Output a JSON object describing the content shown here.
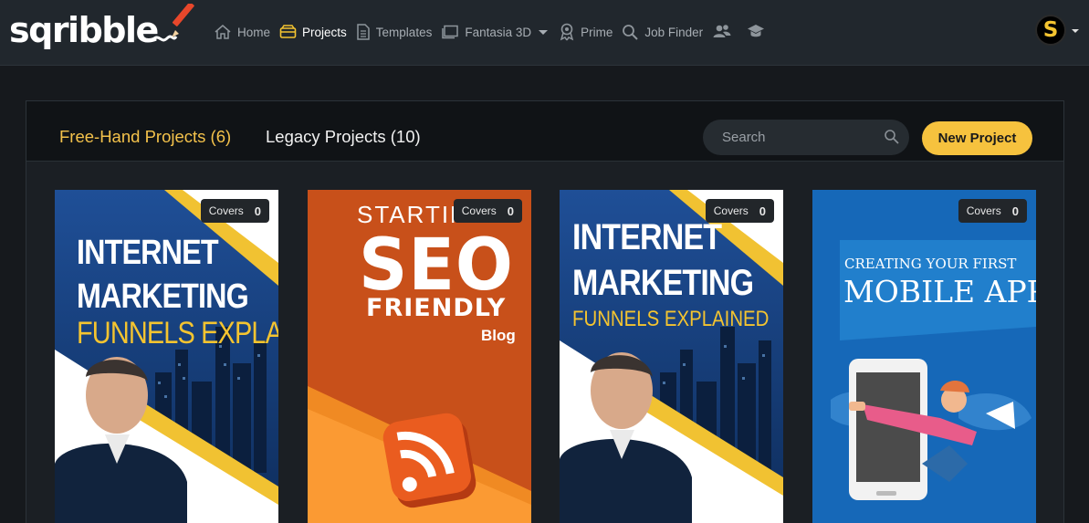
{
  "brand": {
    "name": "sqribble"
  },
  "nav": {
    "items": [
      {
        "label": "Home",
        "icon": "home-icon",
        "active": false
      },
      {
        "label": "Projects",
        "icon": "projects-icon",
        "active": true
      },
      {
        "label": "Templates",
        "icon": "templates-icon",
        "active": false
      },
      {
        "label": "Fantasia 3D",
        "icon": "fantasia-icon",
        "active": false
      },
      {
        "label": "Prime",
        "icon": "prime-icon",
        "active": false
      },
      {
        "label": "Job Finder",
        "icon": "search-icon",
        "active": false
      }
    ],
    "extra_icons": [
      "users-icon",
      "graduation-cap-icon"
    ]
  },
  "user": {
    "avatar_letter": "S"
  },
  "tabs": {
    "free_hand": "Free-Hand Projects (6)",
    "legacy": "Legacy Projects (10)"
  },
  "search": {
    "placeholder": "Search"
  },
  "new_project_label": "New Project",
  "colors": {
    "accent": "#f6c23e",
    "background": "#16191d",
    "topbar": "#21272d",
    "active_tab": "#f4c24b"
  },
  "cards": [
    {
      "badge_label": "Covers",
      "badge_count": "0",
      "title_lines": [
        "INTERNET",
        "MARKETING"
      ],
      "subtitle": "FUNNELS EXPLAINED"
    },
    {
      "badge_label": "Covers",
      "badge_count": "0",
      "title_top": "STARTIN",
      "title_big": "SEO",
      "title_mid": "FRIENDLY",
      "title_small": "Blog"
    },
    {
      "badge_label": "Covers",
      "badge_count": "0",
      "title_lines": [
        "INTERNET",
        "MARKETING"
      ],
      "subtitle": "FUNNELS EXPLAINED"
    },
    {
      "badge_label": "Covers",
      "badge_count": "0",
      "title_top": "CREATING YOUR FIRST",
      "title_big": "MOBILE APP"
    }
  ]
}
